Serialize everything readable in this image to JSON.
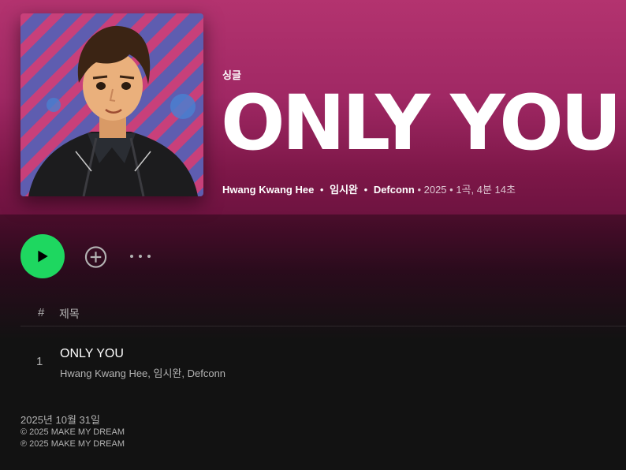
{
  "colors": {
    "accent": "#1ed760",
    "hero_top": "#b3336f",
    "hero_bottom": "#6e1340",
    "background": "#121212",
    "muted_text": "#b3b3b3"
  },
  "album": {
    "type_label": "싱글",
    "title": "ONLY YOU",
    "artists": [
      "Hwang Kwang Hee",
      "임시완",
      "Defconn"
    ],
    "year": "2025",
    "summary": "1곡, 4분 14초",
    "cover_icon": "album-cover-illustration"
  },
  "actions": {
    "play_icon": "play-icon",
    "add_icon": "add-circle-icon",
    "more_icon": "more-options-icon"
  },
  "tracklist": {
    "header_num": "#",
    "header_title": "제목",
    "tracks": [
      {
        "num": "1",
        "title": "ONLY YOU",
        "artists": "Hwang Kwang Hee, 임시완, Defconn"
      }
    ]
  },
  "footer": {
    "release_date": "2025년 10월 31일",
    "copyright": "© 2025 MAKE MY DREAM",
    "phonogram": "℗ 2025 MAKE MY DREAM"
  }
}
